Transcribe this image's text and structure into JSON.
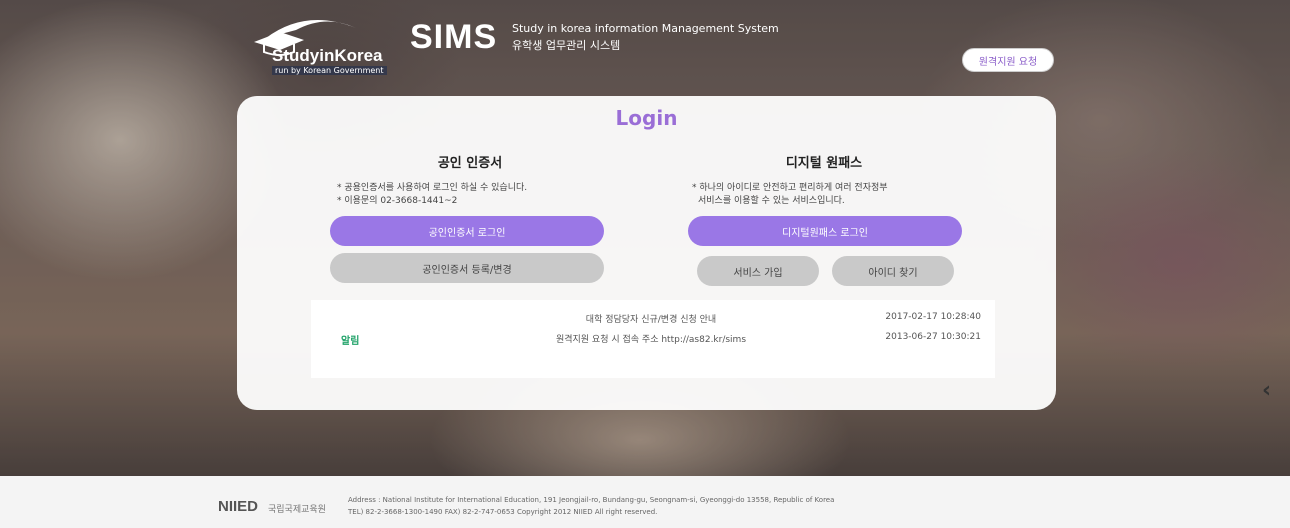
{
  "header": {
    "logo_title": "StudyinKorea",
    "logo_sub": "run by Korean Government",
    "sims_title": "SIMS",
    "sims_en": "Study in korea information Management System",
    "sims_ko": "유학생 업무관리 시스템",
    "remote_request_label": "원격지원 요청"
  },
  "login": {
    "title": "Login",
    "cert": {
      "heading": "공인 인증서",
      "note_line1": "* 공용인증서를 사용하여 로그인 하실 수 있습니다.",
      "note_line2": "* 이용문의 02-3668-1441~2",
      "login_button": "공인인증서 로그인",
      "register_button": "공인인증서 등록/변경"
    },
    "onepass": {
      "heading": "디지털 원패스",
      "note_line1": "* 하나의 아이디로 안전하고 편리하게 여러 전자정부",
      "note_line2": "서비스를 이용할 수 있는 서비스입니다.",
      "login_button": "디지털원패스 로그인",
      "signup_button": "서비스 가입",
      "find_id_button": "아이디 찾기"
    }
  },
  "notices": {
    "tag": "알림",
    "items": [
      {
        "title": "대학 정담당자 신규/변경 신청 안내",
        "date": "2017-02-17 10:28:40"
      },
      {
        "title": "원격지원 요청 시 접속 주소 http://as82.kr/sims",
        "date": "2013-06-27 10:30:21"
      }
    ]
  },
  "footer": {
    "logo": "NIIED",
    "logo_ko": "국립국제교육원",
    "address_line": "Address : National Institute for International Education, 191 Jeongjail-ro, Bundang-gu, Seongnam-si, Gyeonggi-do 13558, Republic of Korea",
    "contact_line": "TEL) 82-2-3668-1300-1490 FAX) 82-2-747-0653 Copyright 2012 NIIED All right reserved."
  },
  "icons": {
    "side_arrow": "chevron-left-icon"
  }
}
